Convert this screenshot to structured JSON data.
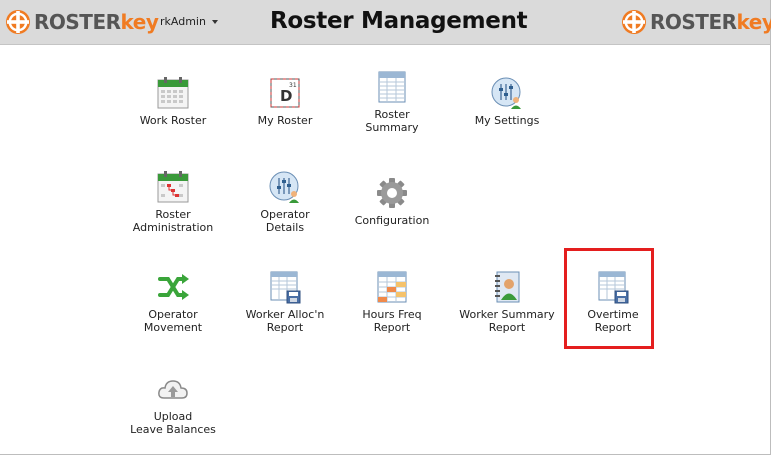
{
  "header": {
    "logo_text_roster": "ROSTER",
    "logo_text_key": "key",
    "user": "rkAdmin",
    "title": "Roster Management"
  },
  "tiles": [
    {
      "label": "Work Roster",
      "icon": "calendar-grid-icon"
    },
    {
      "label": "My Roster",
      "icon": "calendar-day-icon"
    },
    {
      "label": "Roster\nSummary",
      "icon": "spreadsheet-icon"
    },
    {
      "label": "My Settings",
      "icon": "user-settings-icon"
    },
    {
      "label": "Roster\nAdministration",
      "icon": "calendar-admin-icon"
    },
    {
      "label": "Operator\nDetails",
      "icon": "operator-details-icon"
    },
    {
      "label": "Configuration",
      "icon": "gear-icon"
    },
    {
      "label": "Operator\nMovement",
      "icon": "shuffle-icon"
    },
    {
      "label": "Worker Alloc'n\nReport",
      "icon": "report-save-icon"
    },
    {
      "label": "Hours Freq\nReport",
      "icon": "report-colored-icon"
    },
    {
      "label": "Worker Summary\nReport",
      "icon": "notebook-user-icon"
    },
    {
      "label": "Overtime\nReport",
      "icon": "report-save-icon"
    },
    {
      "label": "Upload\nLeave Balances",
      "icon": "cloud-upload-icon"
    }
  ],
  "colors": {
    "header_bg": "#dadada",
    "brand_orange": "#f07b22",
    "brand_gray": "#555555",
    "highlight": "#e41e1e"
  }
}
